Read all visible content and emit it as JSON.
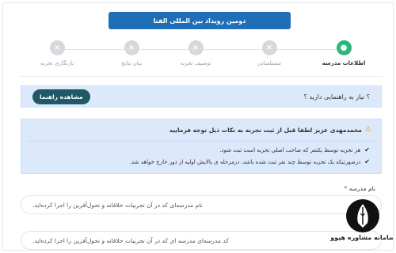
{
  "banner": {
    "title": "دومین رویداد بین المللی الفتا"
  },
  "steps": [
    {
      "label": "اطلاعات مدرسه",
      "icon": "check-icon",
      "symbol": "●",
      "active": true
    },
    {
      "label": "مستلفیاتی",
      "icon": "close-icon",
      "symbol": "×",
      "active": false
    },
    {
      "label": "توصیف تجربه",
      "icon": "close-icon",
      "symbol": "×",
      "active": false
    },
    {
      "label": "بیان نتایج",
      "icon": "close-icon",
      "symbol": "×",
      "active": false
    },
    {
      "label": "بازنگاری تجربه",
      "icon": "close-icon",
      "symbol": "×",
      "active": false
    }
  ],
  "help": {
    "question": "؟  نیاز به راهنمایی دارید ؟",
    "button": "مشاهده راهنما"
  },
  "tips": {
    "title": "محمدمهدی عزیز لطفا قبل از ثبت تجربه به نکات ذیل توجه فرمایید",
    "warn_symbol": "⚠",
    "items": [
      "هر تجربه توسط یکنفر که صاحب اصلی تجربه است ثبت شود.",
      "درصورتیکه یک تجربه توسط چند نفر ثبت شده باشد، درمرحله ی پالایش اولیه از دور خارج خواهد شد."
    ],
    "check_symbol": "✔"
  },
  "form": {
    "school_label": "نام مدرسه",
    "required_mark": "*",
    "school_placeholder": "نام مدرسه‌ای که در آن تجربیات خلاقانه و تحول‌آفرین را اجرا کرده‌اید.",
    "code_placeholder": "کد مدرسه‌ای مدرسه ای که در آن تجربیات خلاقانه و تحول‌آفرین را اجرا کرده‌اید."
  },
  "logo": {
    "caption": "سامانه مشاوره هپوو"
  },
  "colors": {
    "banner": "#1f6fb7",
    "active_step": "#2bb67b",
    "inactive_step": "#d5d8dc",
    "help_bg": "#dbe9fb",
    "help_button": "#1f5866"
  }
}
